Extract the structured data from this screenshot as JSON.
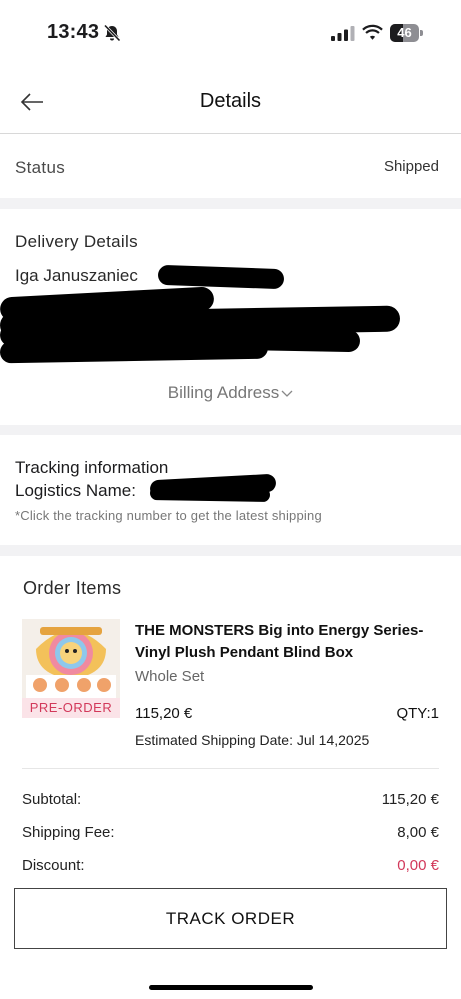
{
  "status_bar": {
    "time": "13:43",
    "battery": "46",
    "battery_level": 0.46
  },
  "header": {
    "title": "Details"
  },
  "status": {
    "label": "Status",
    "value": "Shipped"
  },
  "delivery": {
    "title": "Delivery Details",
    "name": "Iga Januszaniec",
    "billing_label": "Billing Address"
  },
  "tracking": {
    "title": "Tracking information",
    "logistics_label": "Logistics Name:",
    "note": "*Click the tracking number to get the latest shipping"
  },
  "order": {
    "title": "Order Items",
    "item": {
      "name": "THE MONSTERS Big into Energy Series-Vinyl Plush Pendant Blind Box",
      "variant": "Whole Set",
      "price": "115,20 €",
      "qty": "QTY:1",
      "badge": "PRE-ORDER",
      "estimated_shipping": "Estimated Shipping Date: Jul 14,2025"
    },
    "summary": {
      "subtotal_label": "Subtotal:",
      "subtotal": "115,20 €",
      "shipping_label": "Shipping Fee:",
      "shipping": "8,00 €",
      "discount_label": "Discount:",
      "discount": "0,00 €"
    },
    "button": "TRACK ORDER"
  },
  "colors": {
    "accent_red": "#d2385a",
    "gap_gray": "#f2f2f4"
  },
  "icons": [
    "bell-slash-icon",
    "cellular-signal-icon",
    "wifi-icon",
    "battery-icon",
    "back-arrow-icon",
    "chevron-down-icon"
  ]
}
